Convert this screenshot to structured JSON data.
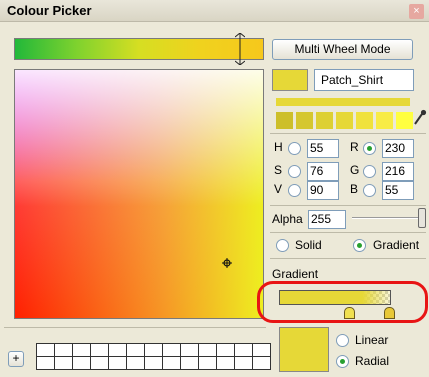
{
  "window": {
    "title": "Colour Picker",
    "close_glyph": "×"
  },
  "mode_button": "Multi Wheel Mode",
  "patch_name": "Patch_Shirt",
  "colors": {
    "current": "#e6d837",
    "palette_swatches": [
      "#cdbf2a",
      "#d5c72f",
      "#ddd033",
      "#e6d837",
      "#f0e23d",
      "#f8ec45"
    ]
  },
  "hsv": {
    "h_label": "H",
    "h": "55",
    "s_label": "S",
    "s": "76",
    "v_label": "V",
    "v": "90"
  },
  "rgb": {
    "r_label": "R",
    "r": "230",
    "g_label": "G",
    "g": "216",
    "b_label": "B",
    "b": "55"
  },
  "alpha": {
    "label": "Alpha",
    "value": "255"
  },
  "fill_type": {
    "solid": "Solid",
    "gradient": "Gradient",
    "selected": "Gradient"
  },
  "gradient": {
    "section_label": "Gradient",
    "linear": "Linear",
    "radial": "Radial",
    "selected": "Radial"
  },
  "icons": {
    "pipette": "eyedropper-icon",
    "crosshair": "crosshair-icon",
    "add": "plus-icon"
  },
  "bottom": {
    "add_label": "+"
  }
}
